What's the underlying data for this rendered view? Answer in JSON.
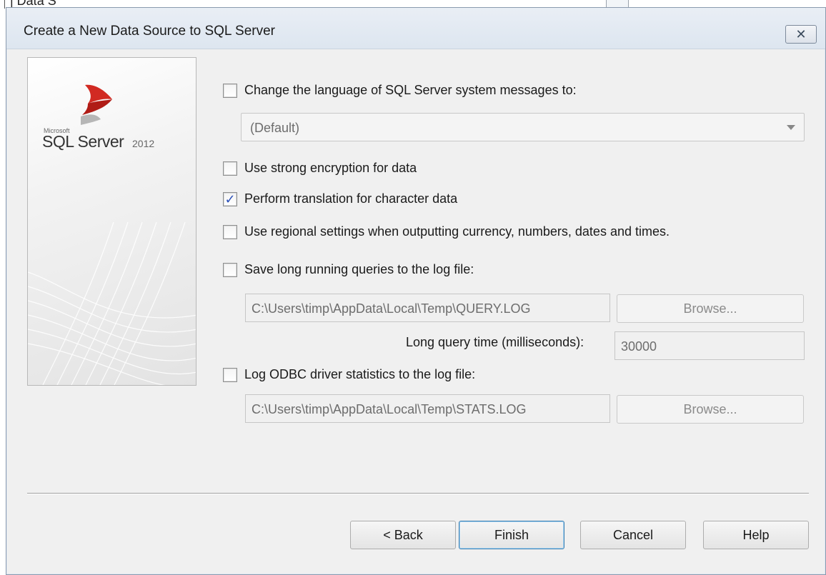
{
  "background_window": {
    "partial_text": "| Data S"
  },
  "dialog": {
    "title": "Create a New Data Source to SQL Server",
    "close_glyph": "✕"
  },
  "logo": {
    "microsoft": "Microsoft",
    "product": "SQL Server",
    "year": "2012"
  },
  "options": {
    "change_language": {
      "label": "Change the language of SQL Server system messages to:",
      "checked": false
    },
    "language_select": {
      "value": "(Default)"
    },
    "strong_encryption": {
      "label": "Use strong encryption for data",
      "checked": false
    },
    "translation": {
      "label": "Perform translation for character data",
      "checked": true
    },
    "regional_settings": {
      "label": "Use regional settings when outputting currency, numbers, dates and times.",
      "checked": false
    },
    "long_queries": {
      "label": "Save long running queries to the log file:",
      "checked": false
    },
    "query_log_path": {
      "value": "C:\\Users\\timp\\AppData\\Local\\Temp\\QUERY.LOG"
    },
    "query_browse": {
      "label": "Browse..."
    },
    "long_query_time": {
      "label": "Long query time (milliseconds):",
      "value": "30000"
    },
    "odbc_stats": {
      "label": "Log ODBC driver statistics to the log file:",
      "checked": false
    },
    "stats_log_path": {
      "value": "C:\\Users\\timp\\AppData\\Local\\Temp\\STATS.LOG"
    },
    "stats_browse": {
      "label": "Browse..."
    }
  },
  "footer": {
    "back": "< Back",
    "finish": "Finish",
    "cancel": "Cancel",
    "help": "Help"
  },
  "colors": {
    "check_mark": "#2a4fb8",
    "title_bar": "#e9eef5"
  }
}
